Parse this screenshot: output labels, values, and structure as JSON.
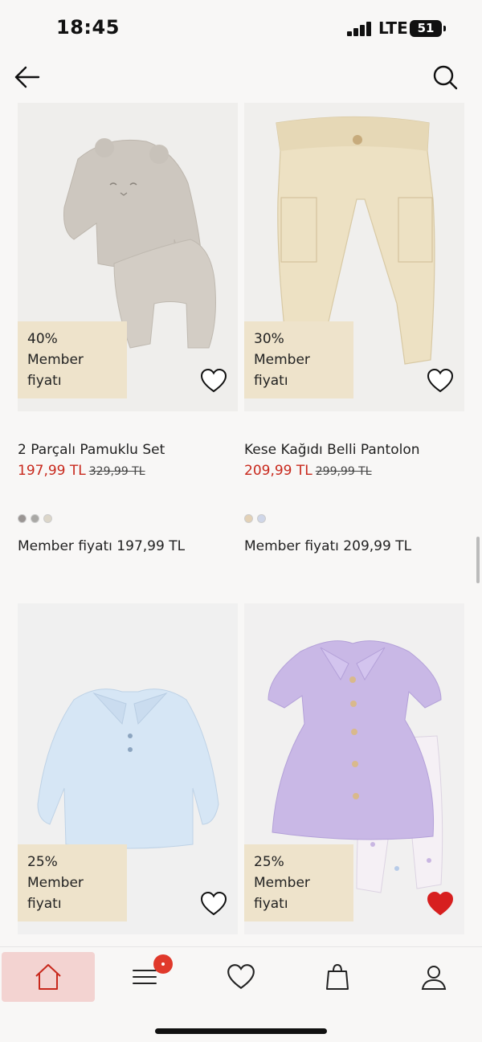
{
  "status_bar": {
    "time": "18:45",
    "network": "LTE",
    "battery": "51"
  },
  "products": [
    {
      "badge": "40% Member\nfiyatı",
      "name": "2 Parçalı Pamuklu Set",
      "price": "197,99 TL",
      "old_price": "329,99 TL",
      "swatches": [
        "#9a9593",
        "#a9a8a5",
        "#dcd6c9"
      ],
      "member_price": "Member fiyatı 197,99 TL",
      "favorited": false
    },
    {
      "badge": "30% Member\nfiyatı",
      "name": "Kese Kağıdı Belli Pantolon",
      "price": "209,99 TL",
      "old_price": "299,99 TL",
      "swatches": [
        "#e3d1b6",
        "#cfd6e8"
      ],
      "member_price": "Member fiyatı 209,99 TL",
      "favorited": false
    },
    {
      "badge": "25% Member\nfiyatı",
      "favorited": false
    },
    {
      "badge": "25% Member\nfiyatı",
      "favorited": true
    }
  ],
  "colors": {
    "accent": "#c8281c",
    "badge_bg": "#eee3cb",
    "fav_active": "#d71f1f",
    "active_tab_bg": "#f3d3d1"
  },
  "bottom_nav": {
    "items": [
      "home-icon",
      "menu-icon",
      "heart-icon",
      "bag-icon",
      "account-icon"
    ],
    "active": "home-icon"
  }
}
